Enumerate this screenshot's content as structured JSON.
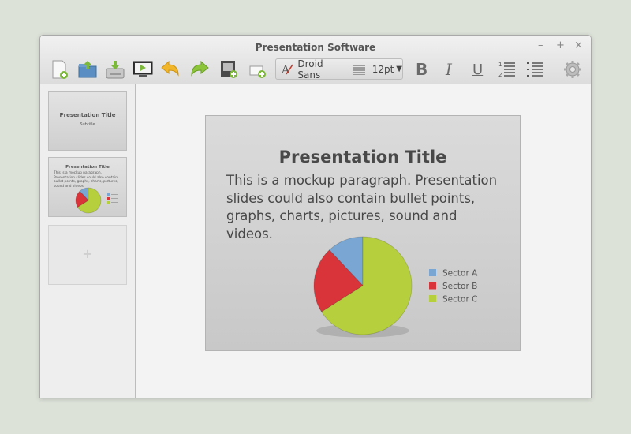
{
  "window": {
    "title": "Presentation Software"
  },
  "controls": {
    "minimize": "–",
    "maximize": "+",
    "close": "×"
  },
  "toolbar": {
    "font_name": "Droid Sans",
    "font_size": "12pt",
    "bold": "B",
    "italic": "I",
    "underline": "U",
    "icons": [
      "new-slide-icon",
      "open-icon",
      "save-icon",
      "play-icon",
      "undo-icon",
      "redo-icon",
      "insert-image-icon",
      "add-text-box-icon",
      "font-icon",
      "align-icon",
      "ordered-list-icon",
      "unordered-list-icon",
      "settings-icon"
    ]
  },
  "thumbnails": [
    {
      "title": "Presentation Title",
      "subtitle": "Subtitle"
    },
    {
      "title": "Presentation Title",
      "body": "This is a mockup paragraph. Presentation slides could also contain bullet points, graphs, charts, pictures, sound and videos."
    },
    {
      "label": "+"
    }
  ],
  "slide": {
    "title": "Presentation Title",
    "body": "This is a mockup paragraph. Presentation slides could also contain bullet points, graphs, charts, pictures, sound and videos."
  },
  "chart_data": {
    "type": "pie",
    "labels": [
      "Sector A",
      "Sector B",
      "Sector C"
    ],
    "values": [
      12,
      22,
      66
    ],
    "colors": [
      "#79a6d2",
      "#d9343a",
      "#b5cf3d"
    ],
    "legend": "right"
  }
}
